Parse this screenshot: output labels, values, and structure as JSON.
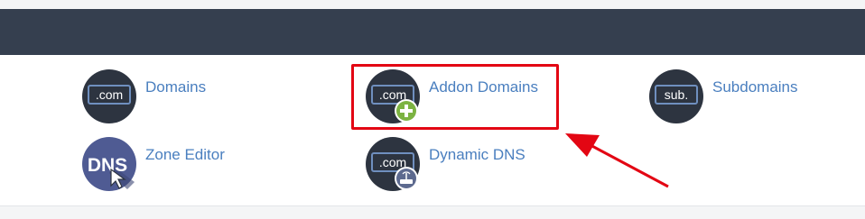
{
  "section": {
    "title": ""
  },
  "items": [
    {
      "label": "Domains",
      "icon_text": ".com"
    },
    {
      "label": "Addon Domains",
      "icon_text": ".com"
    },
    {
      "label": "Subdomains",
      "icon_text": "sub."
    },
    {
      "label": "Zone Editor",
      "icon_text": "DNS"
    },
    {
      "label": "Dynamic DNS",
      "icon_text": ".com"
    }
  ],
  "colors": {
    "header": "#353f4f",
    "link": "#4a7fbf",
    "icon_bg": "#2d3440",
    "highlight": "#e30613",
    "plus_badge": "#7cb342",
    "dns_icon_bg": "#4f5b93"
  }
}
